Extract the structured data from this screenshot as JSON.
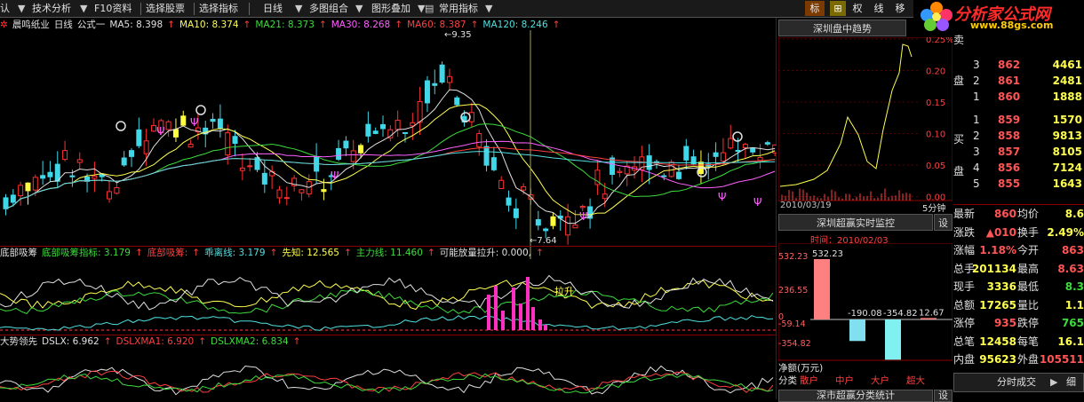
{
  "menubar": {
    "items": [
      "认",
      "技术分析",
      "F10资料",
      "选择股票",
      "选择指标",
      "日线",
      "多图组合",
      "图形叠加",
      "常用指标"
    ],
    "right_buttons": [
      "标",
      "权",
      "线",
      "移"
    ]
  },
  "logo": {
    "title": "分析家公式网",
    "url": "www.88gs.com"
  },
  "main": {
    "title": "晨鸣纸业",
    "period": "日线",
    "formula": "公式一",
    "ma": [
      {
        "label": "MA5: 8.398",
        "color": "#e0e0e0"
      },
      {
        "label": "MA10: 8.374",
        "color": "#ffff50"
      },
      {
        "label": "MA21: 8.373",
        "color": "#3cdc3c"
      },
      {
        "label": "MA30: 8.268",
        "color": "#ff60ff"
      },
      {
        "label": "MA60: 8.387",
        "color": "#ff4040"
      },
      {
        "label": "MA120: 8.246",
        "color": "#50e0e0"
      }
    ],
    "high_label": "9.35",
    "low_label": "7.64"
  },
  "ind1": {
    "name": "底部吸筹",
    "items": [
      {
        "label": "底部吸筹指标: 3.179",
        "color": "#3cdc3c"
      },
      {
        "label": "底部吸筹:",
        "color": "#ff4040"
      },
      {
        "label": "乖离线: 3.179",
        "color": "#50e0e0"
      },
      {
        "label": "先知: 12.565",
        "color": "#ffff50"
      },
      {
        "label": "主力线: 11.460",
        "color": "#3cdc3c"
      },
      {
        "label": "可能放量拉升: 0.000,",
        "color": "#e0e0e0"
      }
    ],
    "annotation": "拉升"
  },
  "ind2": {
    "name": "大势领先",
    "items": [
      {
        "label": "DSLX: 6.962",
        "color": "#e0e0e0"
      },
      {
        "label": "DSLXMA1: 6.920",
        "color": "#ff4040"
      },
      {
        "label": "DSLXMA2: 6.834",
        "color": "#3cdc3c"
      }
    ]
  },
  "trend_panel": {
    "title": "深圳盘中趋势",
    "yticks": [
      "0.25%",
      "0.20",
      "0.15",
      "0.10",
      "0.05",
      "0.00"
    ],
    "date": "2010/03/19",
    "period": "5分钟"
  },
  "monitor_panel": {
    "title": "深圳超赢实时监控",
    "settings": "设",
    "time_label": "时间：2010/02/03",
    "yticks": [
      "532.23",
      "236.55",
      "0",
      "-59.14",
      "-354.82"
    ],
    "values": [
      "532.23",
      "-190.08",
      "-354.82",
      "12.67"
    ],
    "unit": "净额(万元)",
    "category_label": "分类",
    "categories": [
      "散户",
      "中户",
      "大户",
      "超大"
    ]
  },
  "stats_panel": {
    "title": "深市超赢分类统计",
    "settings": "设"
  },
  "quote": {
    "sell_label": "卖盘",
    "buy_label": "买盘",
    "asks": [
      {
        "level": "3",
        "price": "862",
        "vol": "4461"
      },
      {
        "level": "2",
        "price": "861",
        "vol": "2481"
      },
      {
        "level": "1",
        "price": "860",
        "vol": "1888"
      }
    ],
    "bids": [
      {
        "level": "1",
        "price": "859",
        "vol": "1570"
      },
      {
        "level": "2",
        "price": "858",
        "vol": "9813"
      },
      {
        "level": "3",
        "price": "857",
        "vol": "8105"
      },
      {
        "level": "4",
        "price": "856",
        "vol": "7124"
      },
      {
        "level": "5",
        "price": "855",
        "vol": "1643"
      }
    ],
    "stats": [
      {
        "k1": "最新",
        "v1": "860",
        "k2": "均价",
        "v2": "8.6"
      },
      {
        "k1": "涨跌",
        "v1": "▲010",
        "k2": "换手",
        "v2": "2.49%"
      },
      {
        "k1": "涨幅",
        "v1": "1.18%",
        "k2": "今开",
        "v2": "863"
      },
      {
        "k1": "总手",
        "v1": "201134",
        "k2": "最高",
        "v2": "8.63"
      },
      {
        "k1": "现手",
        "v1": "3336",
        "k2": "最低",
        "v2": "8.3"
      },
      {
        "k1": "总额",
        "v1": "17265",
        "k2": "量比",
        "v2": "1.1"
      },
      {
        "k1": "涨停",
        "v1": "935",
        "k2": "跌停",
        "v2": "765"
      },
      {
        "k1": "总笔",
        "v1": "12458",
        "k2": "每笔",
        "v2": "16.1"
      },
      {
        "k1": "内盘",
        "v1": "95623",
        "k2": "外盘",
        "v2": "105511"
      }
    ],
    "tab": "分时成交",
    "tab_btn1": "▶",
    "tab_btn2": "细"
  }
}
